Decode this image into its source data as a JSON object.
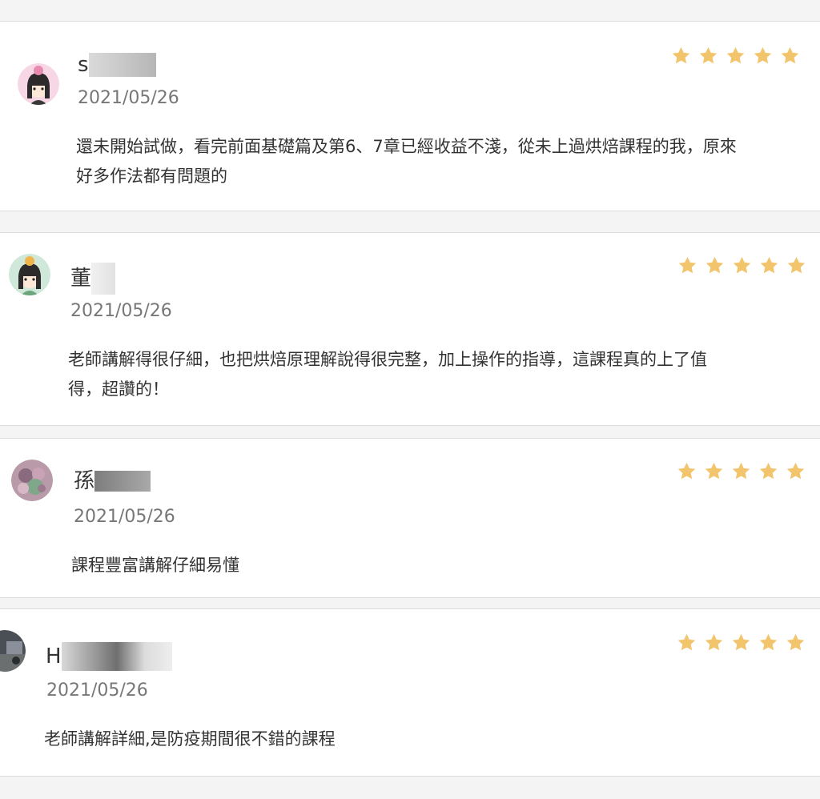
{
  "colors": {
    "star": "#f2c46b",
    "date": "#777777",
    "text": "#333333",
    "card_border": "#dcdcdc"
  },
  "reviews": [
    {
      "name": "s",
      "date": "2021/05/26",
      "rating": 5,
      "comment_lines": [
        "還未開始試做，看完前面基礎篇及第6、7章已經收益不淺，從未上過烘焙課程的我，原來",
        "好多作法都有問題的"
      ]
    },
    {
      "name": "董",
      "date": "2021/05/26",
      "rating": 5,
      "comment_lines": [
        "老師講解得很仔細，也把烘焙原理解說得很完整，加上操作的指導，這課程真的上了值",
        "得，超讚的！"
      ]
    },
    {
      "name": "孫",
      "date": "2021/05/26",
      "rating": 5,
      "comment_lines": [
        "課程豐富講解仔細易懂"
      ]
    },
    {
      "name": "H",
      "date": "2021/05/26",
      "rating": 5,
      "comment_lines": [
        "老師講解詳細,是防疫期間很不錯的課程"
      ]
    }
  ]
}
